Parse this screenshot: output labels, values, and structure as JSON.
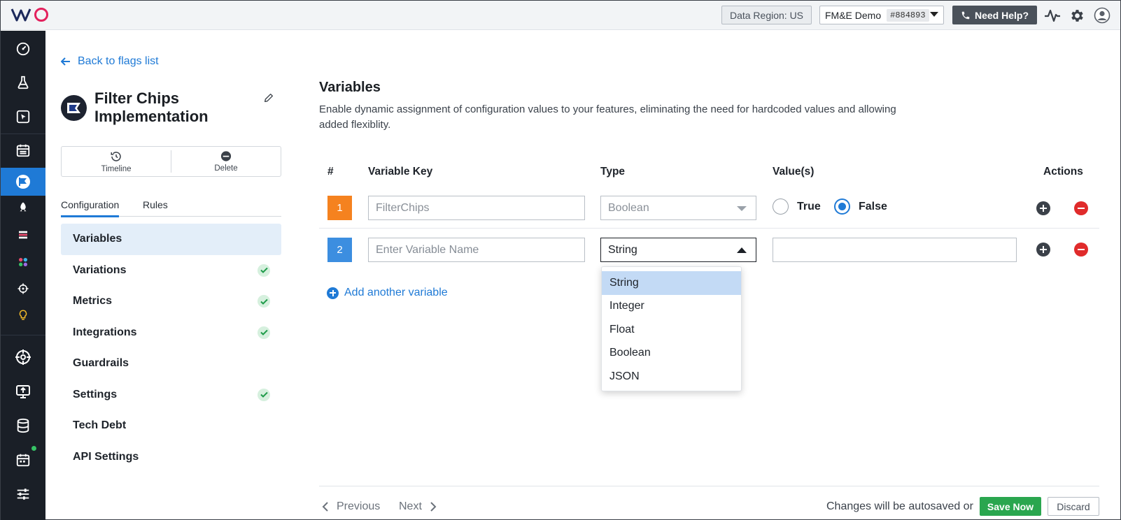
{
  "topbar": {
    "logo_text": "VWO",
    "data_region": "Data Region: US",
    "account_name": "FM&E Demo",
    "account_id": "#884893",
    "help_label": "Need Help?",
    "icons": [
      "activity-icon",
      "gear-icon",
      "user-avatar-icon"
    ]
  },
  "rail": {
    "items": [
      "dashboard-icon",
      "flask-icon",
      "cursor-icon",
      "calendar-icon",
      "flag-icon",
      "rocket-icon",
      "list-icon",
      "apps-icon",
      "target-icon",
      "bulb-icon",
      "crosshair-icon",
      "deploy-icon",
      "database-icon",
      "schedule-icon",
      "sliders-icon"
    ],
    "active": "flag-icon"
  },
  "flag": {
    "back_label": "Back to flags list",
    "title": "Filter Chips Implementation",
    "actions": {
      "timeline": "Timeline",
      "delete": "Delete"
    },
    "tabs": [
      "Configuration",
      "Rules"
    ],
    "menu": [
      {
        "label": "Variables",
        "active": true,
        "done": false
      },
      {
        "label": "Variations",
        "active": false,
        "done": true
      },
      {
        "label": "Metrics",
        "active": false,
        "done": true
      },
      {
        "label": "Integrations",
        "active": false,
        "done": true
      },
      {
        "label": "Guardrails",
        "active": false,
        "done": false
      },
      {
        "label": "Settings",
        "active": false,
        "done": true
      },
      {
        "label": "Tech Debt",
        "active": false,
        "done": false
      },
      {
        "label": "API Settings",
        "active": false,
        "done": false
      }
    ]
  },
  "variables": {
    "title": "Variables",
    "description": "Enable dynamic assignment of configuration values to your features, eliminating the need for hardcoded values and allowing added flexiblity.",
    "headers": {
      "num": "#",
      "key": "Variable Key",
      "type": "Type",
      "values": "Value(s)",
      "actions": "Actions"
    },
    "rows": [
      {
        "num": "1",
        "key": "FilterChips",
        "type": "Boolean",
        "true_label": "True",
        "false_label": "False",
        "selected": "False"
      },
      {
        "num": "2",
        "key_placeholder": "Enter Variable Name",
        "type": "String",
        "value": ""
      }
    ],
    "add_label": "Add another variable",
    "type_options": [
      "String",
      "Integer",
      "Float",
      "Boolean",
      "JSON"
    ],
    "type_selected": "String"
  },
  "footer": {
    "previous": "Previous",
    "next": "Next",
    "autosave": "Changes will be autosaved or",
    "save": "Save Now",
    "discard": "Discard"
  },
  "colors": {
    "accent": "#1f7ad6",
    "row1_badge": "#f5821f",
    "row2_badge": "#3c8ee0",
    "save": "#2aa64f",
    "remove": "#e02b2b",
    "rail_bg": "#1a1f27"
  }
}
